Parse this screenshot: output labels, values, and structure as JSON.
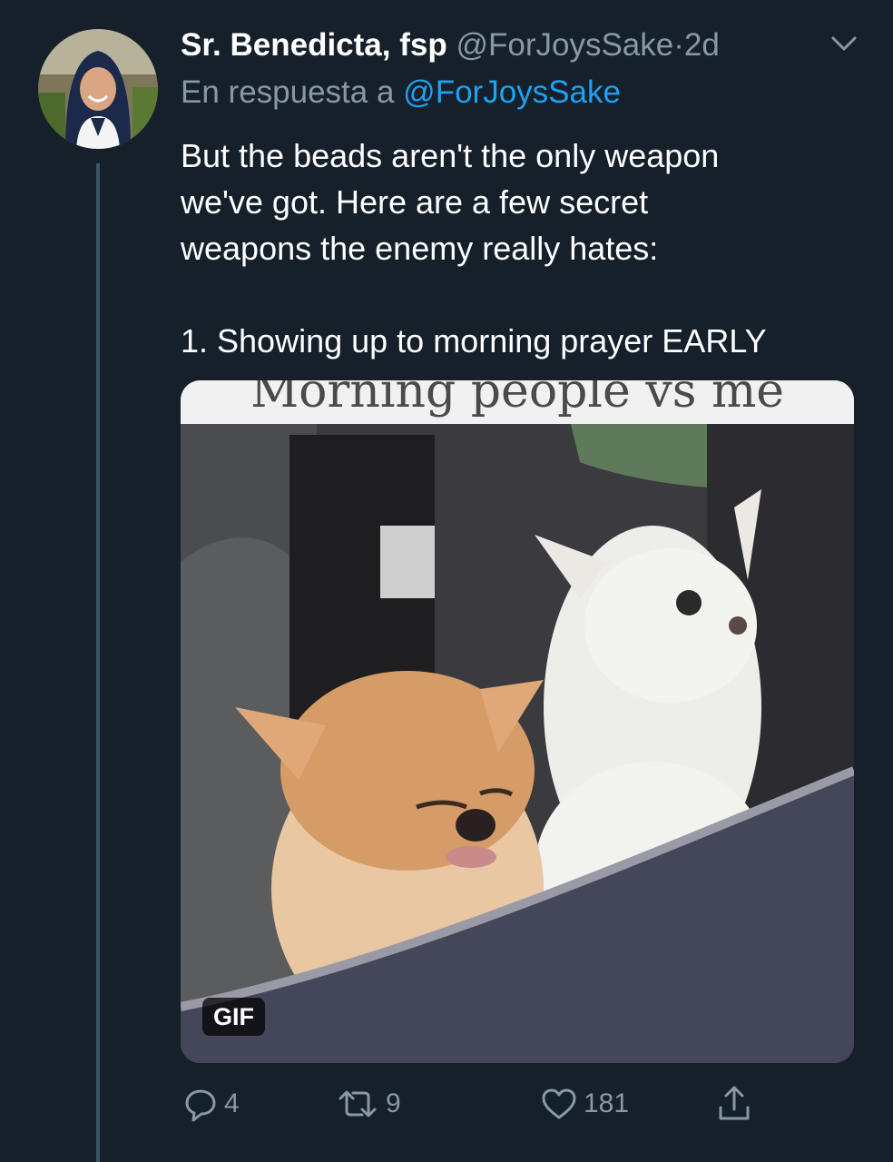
{
  "tweet": {
    "author_name": "Sr. Benedicta, fsp",
    "handle": "@ForJoysSake",
    "separator": "·",
    "time": "2d",
    "reply_prefix": "En respuesta a",
    "reply_to": "@ForJoysSake",
    "text_lines": [
      "But the beads aren't the only weapon",
      "we've got. Here are a few secret",
      "weapons the enemy really hates:",
      "1. Showing up to morning prayer EARLY"
    ],
    "media": {
      "caption": "Morning people vs me",
      "badge": "GIF"
    },
    "actions": {
      "reply_count": "4",
      "retweet_count": "9",
      "like_count": "181"
    }
  },
  "icons": [
    "chevron-down-icon",
    "reply-icon",
    "retweet-icon",
    "like-icon",
    "share-icon"
  ],
  "colors": {
    "background": "#15202b",
    "text": "#ffffff",
    "secondary": "#8899a6",
    "link": "#1da1f2",
    "thread_line": "#3d5466"
  }
}
